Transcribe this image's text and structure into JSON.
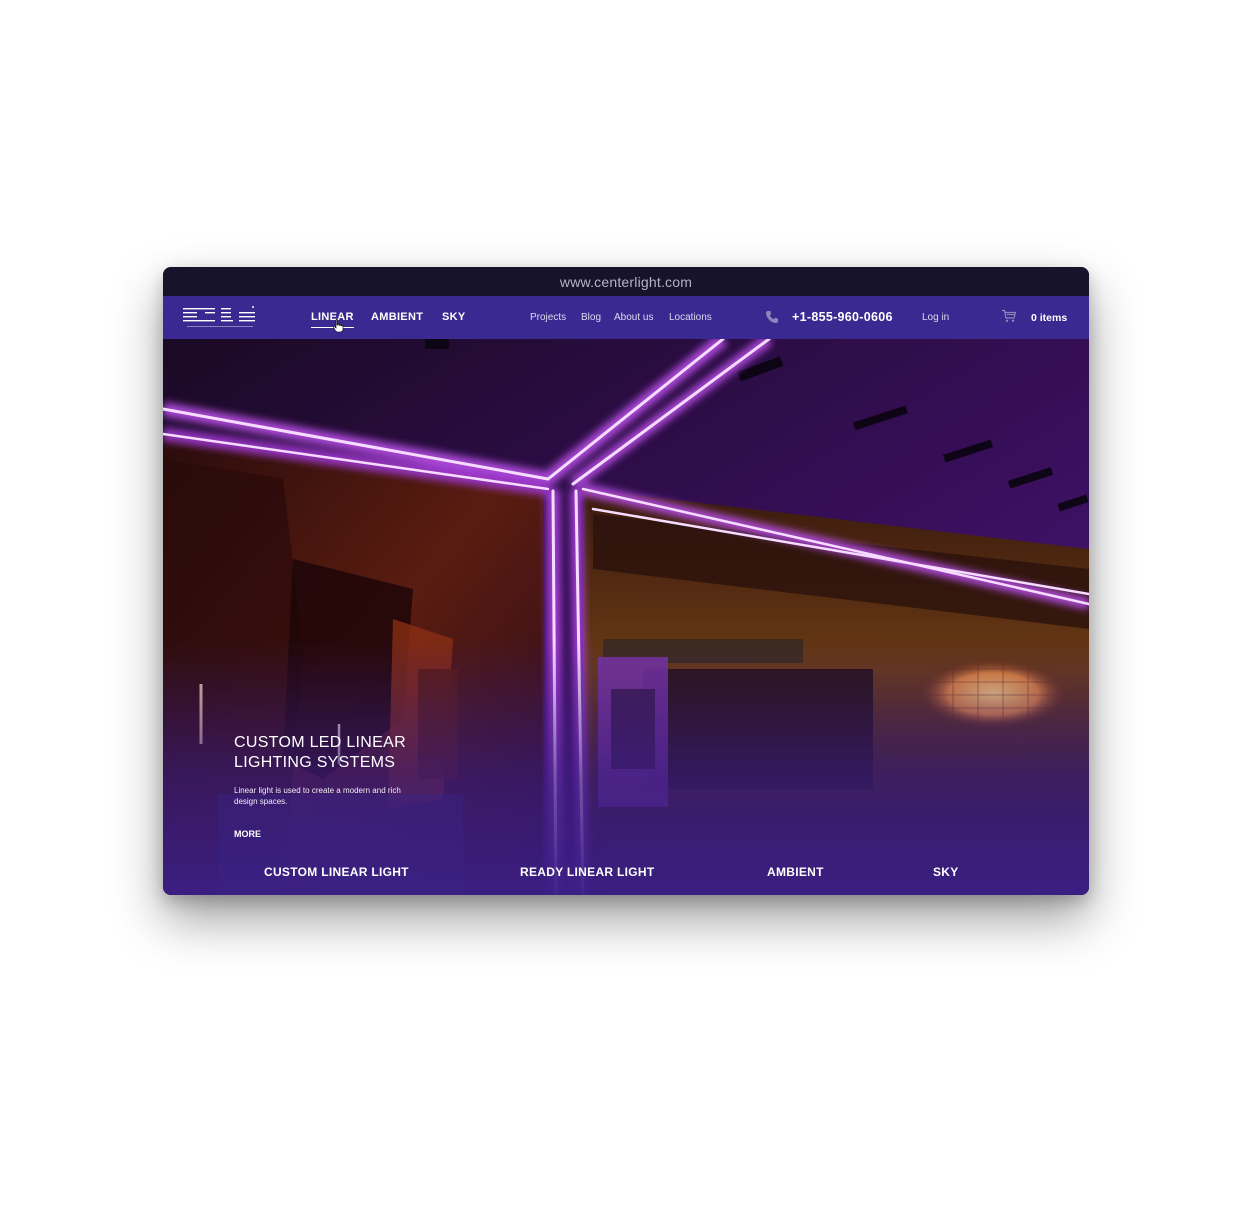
{
  "browser": {
    "url": "www.centerlight.com"
  },
  "nav": {
    "main_links": [
      "LINEAR",
      "AMBIENT",
      "SKY"
    ],
    "secondary_links": [
      "Projects",
      "Blog",
      "About us",
      "Locations"
    ],
    "phone": "+1-855-960-0606",
    "login": "Log in",
    "cart_items": "0 items"
  },
  "hero": {
    "title": "CUSTOM LED LINEAR LIGHTING SYSTEMS",
    "description": "Linear light is used to create a modern and rich design spaces.",
    "more": "MORE"
  },
  "categories": [
    "CUSTOM LINEAR LIGHT",
    "READY LINEAR LIGHT",
    "AMBIENT",
    "SKY"
  ],
  "colors": {
    "nav_bg": "#3a2990",
    "url_bar_bg": "#16132b",
    "neon": "#e7b4ff"
  },
  "icons": [
    "logo-icon",
    "phone-icon",
    "cart-icon",
    "pointer-cursor-icon"
  ]
}
